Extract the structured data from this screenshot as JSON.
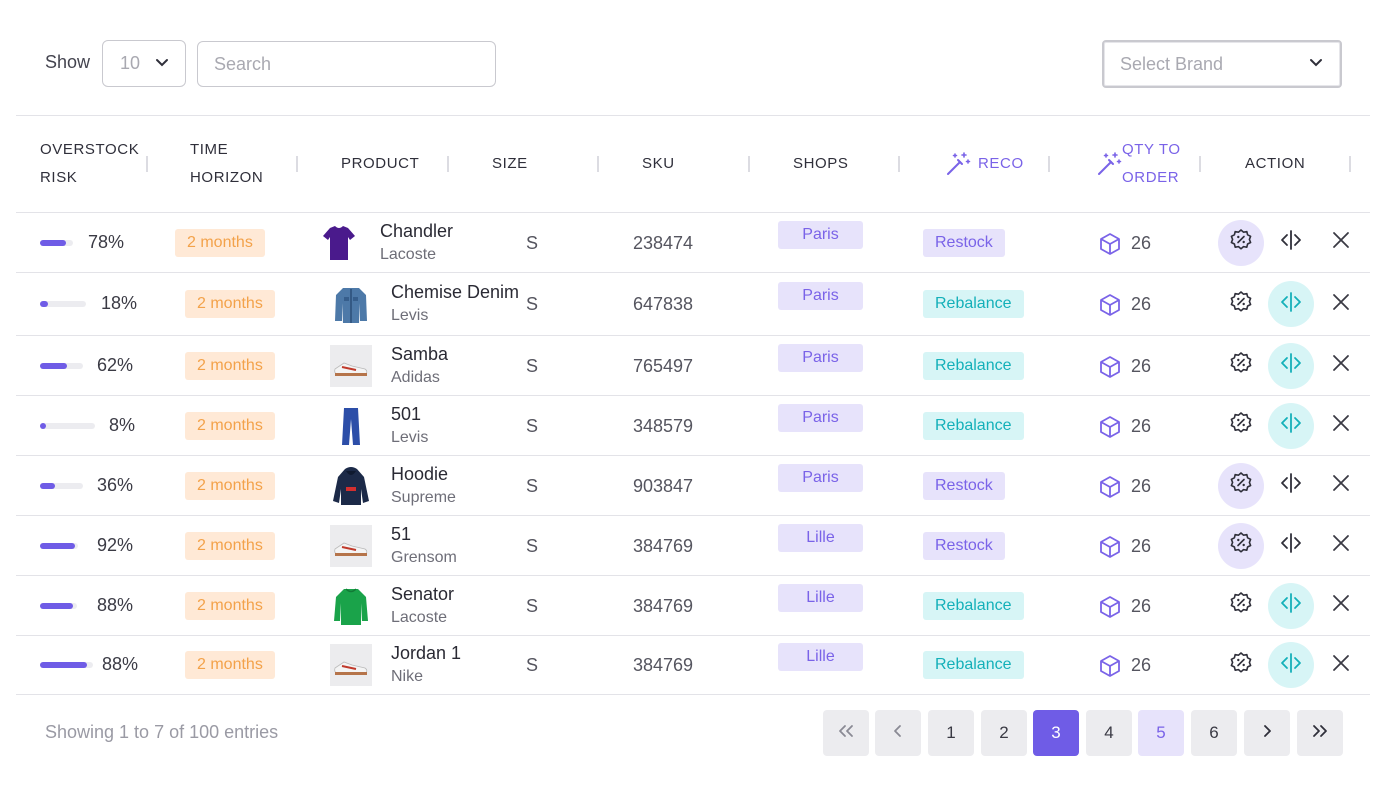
{
  "toolbar": {
    "show_label": "Show",
    "show_value": "10",
    "search_placeholder": "Search",
    "brand_placeholder": "Select Brand"
  },
  "columns": {
    "overstock_risk": [
      "OVERSTOCK",
      "RISK"
    ],
    "time_horizon": [
      "TIME",
      "HORIZON"
    ],
    "product": "PRODUCT",
    "size": "SIZE",
    "sku": "SKU",
    "shops": "SHOPS",
    "reco": "RECO",
    "qty_to_order": [
      "QTY TO",
      "ORDER"
    ],
    "action": "ACTION"
  },
  "colors": {
    "accent": "#6f5ce6",
    "restock_bg": "#e7e3fb",
    "rebalance_bg": "#d7f5f6",
    "rebalance_text": "#14b0b9",
    "horizon_bg": "#ffe9d6",
    "horizon_text": "#f3a24a"
  },
  "rows": [
    {
      "risk_pct": "78%",
      "risk_fill": 0.78,
      "horizon": "2 months",
      "product": "Chandler",
      "brand": "Lacoste",
      "thumb_icon": "tshirt-icon",
      "size": "S",
      "sku": "238474",
      "shop": "Paris",
      "reco": "Restock",
      "qty": "26",
      "active_action": "optimize"
    },
    {
      "risk_pct": "18%",
      "risk_fill": 0.18,
      "horizon": "2 months",
      "product": "Chemise Denim",
      "brand": "Levis",
      "thumb_icon": "denim-jacket-icon",
      "size": "S",
      "sku": "647838",
      "shop": "Paris",
      "reco": "Rebalance",
      "qty": "26",
      "active_action": "rebalance"
    },
    {
      "risk_pct": "62%",
      "risk_fill": 0.62,
      "horizon": "2 months",
      "product": "Samba",
      "brand": "Adidas",
      "thumb_icon": "sneaker-icon",
      "size": "S",
      "sku": "765497",
      "shop": "Paris",
      "reco": "Rebalance",
      "qty": "26",
      "active_action": "rebalance"
    },
    {
      "risk_pct": "8%",
      "risk_fill": 0.08,
      "horizon": "2 months",
      "product": "501",
      "brand": "Levis",
      "thumb_icon": "jeans-icon",
      "size": "S",
      "sku": "348579",
      "shop": "Paris",
      "reco": "Rebalance",
      "qty": "26",
      "active_action": "rebalance"
    },
    {
      "risk_pct": "36%",
      "risk_fill": 0.36,
      "horizon": "2 months",
      "product": "Hoodie",
      "brand": "Supreme",
      "thumb_icon": "hoodie-icon",
      "size": "S",
      "sku": "903847",
      "shop": "Paris",
      "reco": "Restock",
      "qty": "26",
      "active_action": "optimize"
    },
    {
      "risk_pct": "92%",
      "risk_fill": 0.92,
      "horizon": "2 months",
      "product": "51",
      "brand": "Grensom",
      "thumb_icon": "sneaker-icon",
      "size": "S",
      "sku": "384769",
      "shop": "Lille",
      "reco": "Restock",
      "qty": "26",
      "active_action": "optimize"
    },
    {
      "risk_pct": "88%",
      "risk_fill": 0.88,
      "horizon": "2 months",
      "product": "Senator",
      "brand": "Lacoste",
      "thumb_icon": "sweater-icon",
      "size": "S",
      "sku": "384769",
      "shop": "Lille",
      "reco": "Rebalance",
      "qty": "26",
      "active_action": "rebalance"
    },
    {
      "risk_pct": "88%",
      "risk_fill": 0.88,
      "horizon": "2 months",
      "product": "Jordan 1",
      "brand": "Nike",
      "thumb_icon": "sneaker-icon",
      "size": "S",
      "sku": "384769",
      "shop": "Lille",
      "reco": "Rebalance",
      "qty": "26",
      "active_action": "rebalance"
    }
  ],
  "footer": {
    "showing_text": "Showing 1 to 7 of 100 entries",
    "pages": [
      "1",
      "2",
      "3",
      "4",
      "5",
      "6"
    ],
    "current_page": "3",
    "hovered_page": "5"
  }
}
